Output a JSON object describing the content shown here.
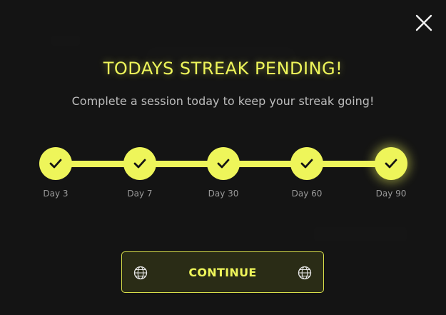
{
  "modal": {
    "title": "TODAYS STREAK PENDING!",
    "subtitle": "Complete a session today to keep your streak going!",
    "continue_label": "CONTINUE"
  },
  "milestones": [
    {
      "label": "Day 3",
      "completed": true
    },
    {
      "label": "Day 7",
      "completed": true
    },
    {
      "label": "Day 30",
      "completed": true
    },
    {
      "label": "Day 60",
      "completed": true
    },
    {
      "label": "Day 90",
      "completed": true
    }
  ],
  "colors": {
    "accent": "#eef55a",
    "overlay": "#121212",
    "subtitle": "#bdbdbd",
    "milestone_label": "#9a9a9a"
  },
  "icons": {
    "close": "close-icon",
    "check": "check-icon",
    "globe": "globe-icon"
  }
}
